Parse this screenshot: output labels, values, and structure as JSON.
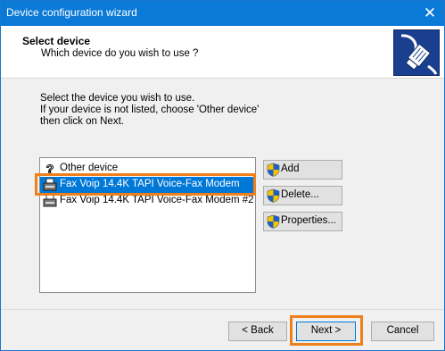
{
  "window": {
    "title": "Device configuration wizard",
    "close_glyph": "✕"
  },
  "header": {
    "title": "Select device",
    "subtitle": "Which device do you wish to use ?",
    "icon": "network-plug-icon"
  },
  "instructions": {
    "line1": "Select the device you wish to use.",
    "line2": "If your device is not listed, choose 'Other device'",
    "line3": "then click on Next."
  },
  "devices": {
    "items": [
      {
        "label": "Other device",
        "icon": "question-mark-icon",
        "selected": false
      },
      {
        "label": "Fax Voip 14.4K TAPI Voice-Fax Modem",
        "icon": "fax-modem-icon",
        "selected": true
      },
      {
        "label": "Fax Voip 14.4K TAPI Voice-Fax Modem #2",
        "icon": "fax-modem-icon",
        "selected": false
      }
    ]
  },
  "actions": {
    "add": "Add",
    "delete": "Delete...",
    "properties": "Properties..."
  },
  "footer": {
    "back": "< Back",
    "next": "Next >",
    "cancel": "Cancel"
  },
  "colors": {
    "titlebar": "#0b7ad6",
    "selection": "#0078d7",
    "highlight": "#ef7f1a"
  }
}
